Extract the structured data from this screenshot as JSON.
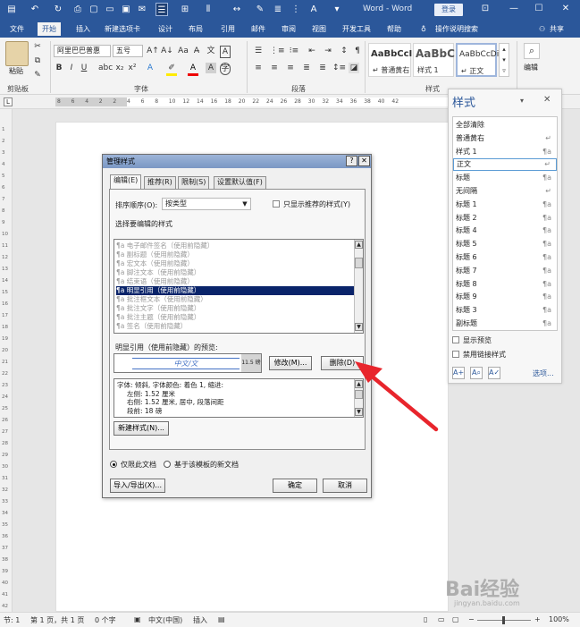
{
  "titlebar": {
    "title": "Word - Word",
    "login": "登录"
  },
  "menu": [
    "文件",
    "开始",
    "插入",
    "新建选项卡",
    "设计",
    "布局",
    "引用",
    "邮件",
    "审阅",
    "视图",
    "开发工具",
    "帮助"
  ],
  "menu_help_search": "操作说明搜索",
  "menu_share": "共享",
  "ribbon": {
    "paste_label": "粘贴",
    "font_name": "阿里巴巴普惠",
    "font_size": "五号",
    "style1_preview": "AaBbCcI",
    "style1_name": "↵ 普通黄右",
    "style2_preview": "AaBbC",
    "style2_name": "样式 1",
    "style3_preview": "AaBbCcDi",
    "style3_name": "↵ 正文",
    "edit_label": "编辑",
    "group_clipboard": "剪贴板",
    "group_font": "字体",
    "group_paragraph": "段落",
    "group_styles": "样式"
  },
  "ruler_nums": [
    "8",
    "6",
    "4",
    "2",
    "2",
    "4",
    "6",
    "8",
    "10",
    "12",
    "14",
    "16",
    "18",
    "20",
    "22",
    "24",
    "26",
    "28",
    "30",
    "32",
    "34",
    "36",
    "38",
    "40",
    "42"
  ],
  "vruler_nums": [
    "1",
    "2",
    "3",
    "4",
    "5",
    "6",
    "7",
    "8",
    "9",
    "10",
    "11",
    "12",
    "13",
    "14",
    "15",
    "16",
    "17",
    "18",
    "19",
    "20",
    "21",
    "22",
    "23",
    "24",
    "25",
    "26",
    "27",
    "28",
    "29",
    "30",
    "31",
    "32",
    "33",
    "34",
    "35",
    "36",
    "37",
    "38",
    "39",
    "40",
    "41",
    "42"
  ],
  "styles_pane": {
    "title": "样式",
    "items": [
      {
        "name": "全部清除",
        "mark": ""
      },
      {
        "name": "普通黄右",
        "mark": "↵"
      },
      {
        "name": "样式 1",
        "mark": "¶a"
      },
      {
        "name": "正文",
        "mark": "↵"
      },
      {
        "name": "标题",
        "mark": "¶a"
      },
      {
        "name": "无间隔",
        "mark": "↵"
      },
      {
        "name": "标题 1",
        "mark": "¶a"
      },
      {
        "name": "标题 2",
        "mark": "¶a"
      },
      {
        "name": "标题 4",
        "mark": "¶a"
      },
      {
        "name": "标题 5",
        "mark": "¶a"
      },
      {
        "name": "标题 6",
        "mark": "¶a"
      },
      {
        "name": "标题 7",
        "mark": "¶a"
      },
      {
        "name": "标题 8",
        "mark": "¶a"
      },
      {
        "name": "标题 9",
        "mark": "¶a"
      },
      {
        "name": "标题 3",
        "mark": "¶a"
      },
      {
        "name": "副标题",
        "mark": "¶a"
      }
    ],
    "show_preview": "显示预览",
    "disable_linked": "禁用链接样式",
    "options": "选项..."
  },
  "dialog": {
    "title": "管理样式",
    "tabs": [
      "编辑(E)",
      "推荐(R)",
      "限制(S)",
      "设置默认值(F)"
    ],
    "sort_label": "排序顺序(O):",
    "sort_value": "按类型",
    "only_recommended": "只显示推荐的样式(Y)",
    "select_label": "选择要编辑的样式",
    "styles": [
      {
        "text": "¶a 电子邮件签名（使用前隐藏）"
      },
      {
        "text": "¶a 副标题（使用前隐藏）"
      },
      {
        "text": "¶a 宏文本（使用前隐藏）"
      },
      {
        "text": "¶a 脚注文本（使用前隐藏）"
      },
      {
        "text": "¶a 结束语（使用前隐藏）"
      },
      {
        "text": "¶a 明显引用（使用前隐藏）"
      },
      {
        "text": "¶a 批注框文本（使用前隐藏）"
      },
      {
        "text": "¶a 批注文字（使用前隐藏）"
      },
      {
        "text": "¶a 批注主题（使用前隐藏）"
      },
      {
        "text": "¶a 签名（使用前隐藏）"
      }
    ],
    "selected_index": 5,
    "preview_label": "明显引用（使用前隐藏）的预览:",
    "preview_text": "中文/文",
    "preview_small": "11.5 磅",
    "modify_btn": "修改(M)...",
    "delete_btn": "删除(D)",
    "desc_lines": [
      "字体: 倾斜, 字体颜色: 着色 1, 缩进:",
      "左侧: 1.52 厘米",
      "右侧: 1.52 厘米, 居中, 段落间距",
      "段前: 18 磅"
    ],
    "new_style_btn": "新建样式(N)...",
    "only_doc": "仅限此文档",
    "template_doc": "基于该模板的新文档",
    "import_export": "导入/导出(X)...",
    "ok": "确定",
    "cancel": "取消"
  },
  "status": {
    "section": "节: 1",
    "page": "第 1 页，共 1 页",
    "words": "0 个字",
    "lang": "中文(中国)",
    "insert": "插入",
    "zoom": "100%"
  },
  "watermark": {
    "text": "Bai经验",
    "sub": "jingyan.baidu.com"
  }
}
